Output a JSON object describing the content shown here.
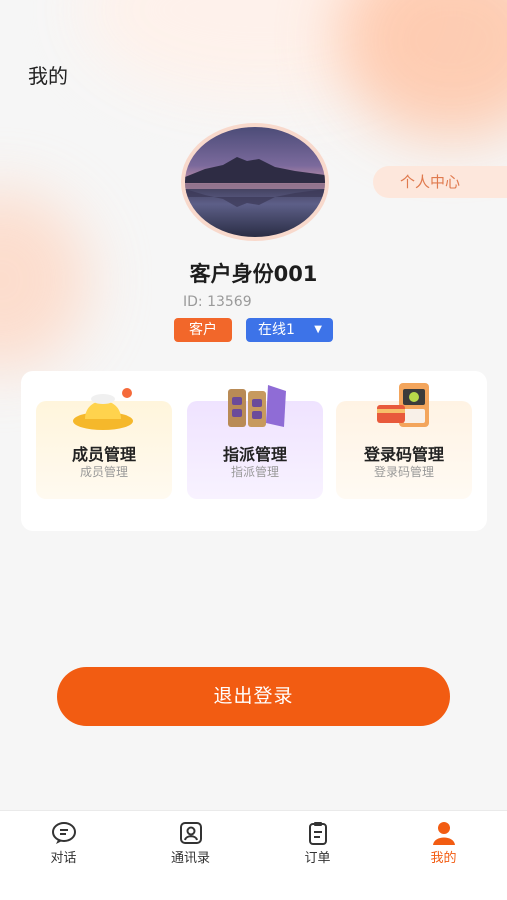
{
  "header": {
    "title": "我的"
  },
  "profile": {
    "name": "客户身份001",
    "id_text": "ID: 13569",
    "role_badge": "客户",
    "status": "在线1",
    "status_caret": "▼",
    "personal_center_label": "个人中心"
  },
  "features": [
    {
      "title": "成员管理",
      "subtitle": "成员管理",
      "icon": "hat-icon"
    },
    {
      "title": "指派管理",
      "subtitle": "指派管理",
      "icon": "folders-icon"
    },
    {
      "title": "登录码管理",
      "subtitle": "登录码管理",
      "icon": "pos-terminal-icon"
    }
  ],
  "logout_label": "退出登录",
  "tabbar": {
    "items": [
      {
        "label": "对话",
        "icon": "chat-icon",
        "active": false
      },
      {
        "label": "通讯录",
        "icon": "contacts-icon",
        "active": false
      },
      {
        "label": "订单",
        "icon": "order-icon",
        "active": false
      },
      {
        "label": "我的",
        "icon": "person-icon",
        "active": true
      }
    ]
  },
  "colors": {
    "accent": "#f25c12",
    "role_badge": "#f2672a",
    "status_badge": "#3d73e8",
    "personal_center_bg": "#fde7dc",
    "personal_center_text": "#e07a4e"
  }
}
